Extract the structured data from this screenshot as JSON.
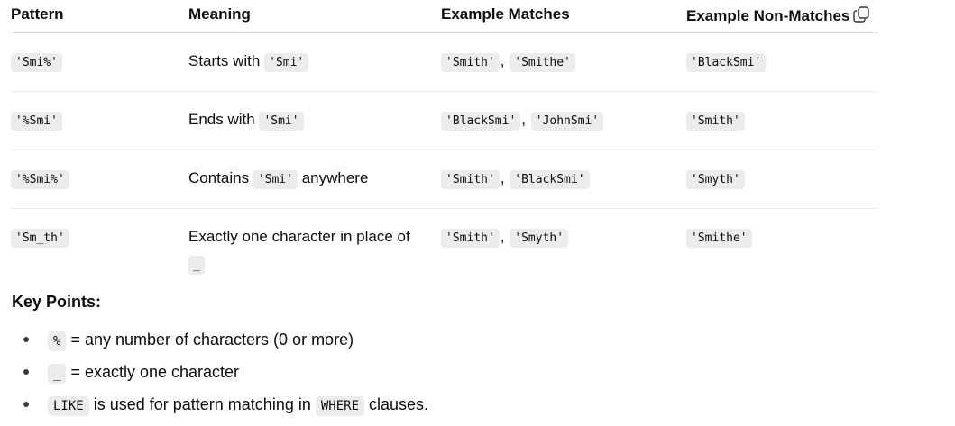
{
  "table": {
    "headers": [
      "Pattern",
      "Meaning",
      "Example Matches",
      "Example Non-Matches"
    ],
    "rows": [
      {
        "pattern": "'Smi%'",
        "meaning_pre": "Starts with ",
        "meaning_code": "'Smi'",
        "meaning_post": "",
        "matches": [
          "'Smith'",
          "'Smithe'"
        ],
        "non_match": "'BlackSmi'"
      },
      {
        "pattern": "'%Smi'",
        "meaning_pre": "Ends with ",
        "meaning_code": "'Smi'",
        "meaning_post": "",
        "matches": [
          "'BlackSmi'",
          "'JohnSmi'"
        ],
        "non_match": "'Smith'"
      },
      {
        "pattern": "'%Smi%'",
        "meaning_pre": "Contains ",
        "meaning_code": "'Smi'",
        "meaning_post": " anywhere",
        "matches": [
          "'Smith'",
          "'BlackSmi'"
        ],
        "non_match": "'Smyth'"
      },
      {
        "pattern": "'Sm_th'",
        "meaning_pre": "Exactly one character in place of ",
        "meaning_code": "_",
        "meaning_post": "",
        "matches": [
          "'Smith'",
          "'Smyth'"
        ],
        "non_match": "'Smithe'"
      }
    ],
    "match_separator": ",",
    "copy_icon": "copy-icon"
  },
  "key_points": {
    "title": "Key Points:",
    "items": [
      {
        "code": "%",
        "text": " = any number of characters (0 or more)"
      },
      {
        "code": "_",
        "text": " = exactly one character"
      },
      {
        "code": "LIKE",
        "text": " is used for pattern matching in ",
        "code2": "WHERE",
        "text2": " clauses."
      }
    ]
  }
}
